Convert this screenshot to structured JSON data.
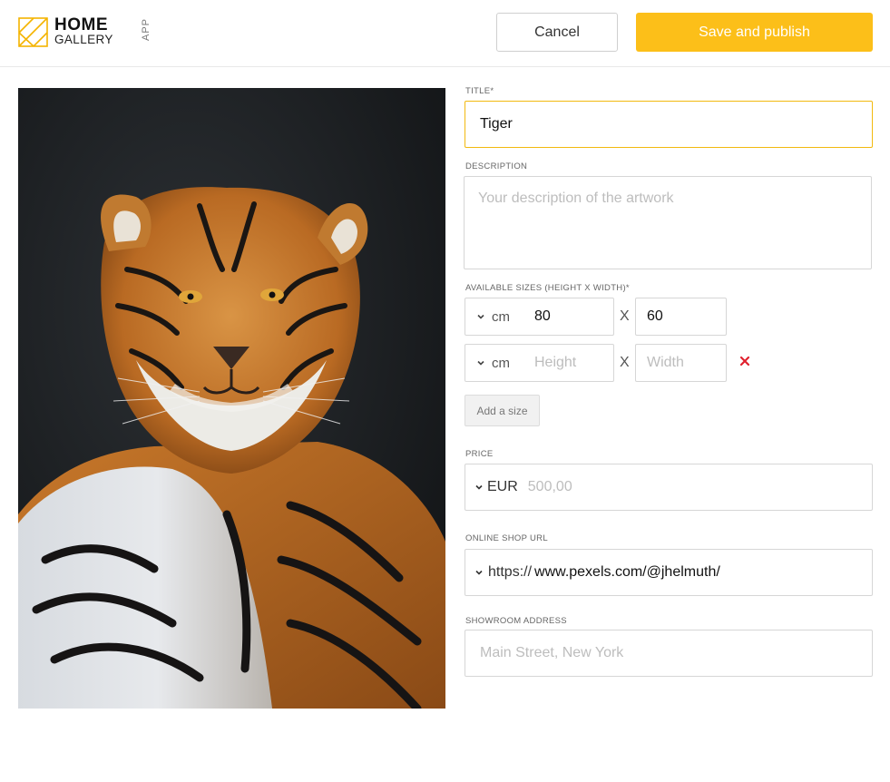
{
  "header": {
    "logo": {
      "word1": "HOME",
      "word2": "GALLERY",
      "word3": "APP"
    },
    "cancel_label": "Cancel",
    "save_label": "Save and publish"
  },
  "colors": {
    "accent": "#fcbf19",
    "remove": "#e0212e"
  },
  "artwork": {
    "subject": "tiger-photo"
  },
  "form": {
    "title": {
      "label": "TITLE*",
      "value": "Tiger"
    },
    "description": {
      "label": "DESCRIPTION",
      "placeholder": "Your description of the artwork"
    },
    "sizes": {
      "label": "AVAILABLE SIZES (HEIGHT X WIDTH)*",
      "separator": "X",
      "rows": [
        {
          "unit": "cm",
          "height": "80",
          "width": "60",
          "height_placeholder": "Height",
          "width_placeholder": "Width"
        },
        {
          "unit": "cm",
          "height": "",
          "width": "",
          "height_placeholder": "Height",
          "width_placeholder": "Width"
        }
      ],
      "add_label": "Add a size"
    },
    "price": {
      "label": "PRICE",
      "currency": "EUR",
      "placeholder": "500,00"
    },
    "shop_url": {
      "label": "ONLINE SHOP URL",
      "protocol": "https://",
      "value": "www.pexels.com/@jhelmuth/"
    },
    "showroom": {
      "label": "SHOWROOM ADDRESS",
      "placeholder": "Main Street, New York"
    }
  }
}
